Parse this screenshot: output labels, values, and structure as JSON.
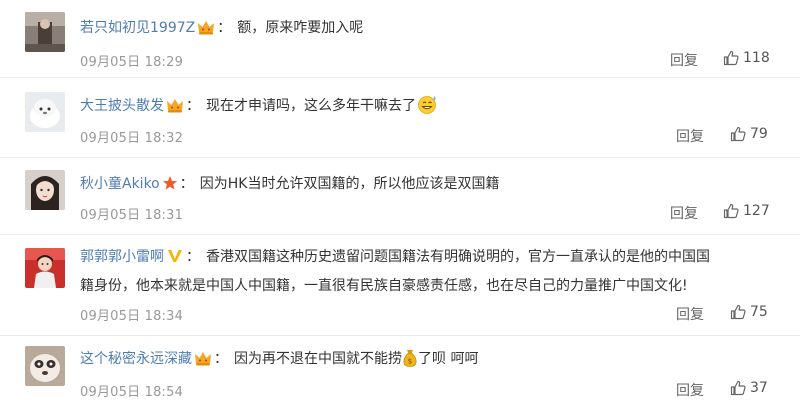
{
  "comments": [
    {
      "username": "若只如初见1997Z",
      "badge": "crown-icon",
      "text": "额，原来咋要加入呢",
      "text_suffix": "",
      "time": "09月05日 18:29",
      "reply_label": "回复",
      "likes": "118"
    },
    {
      "username": "大王披头散发",
      "badge": "crown-icon",
      "text": "现在才申请吗，这么多年干嘛去了",
      "text_suffix": "",
      "emoji": "sweat-grin-emoji",
      "time": "09月05日 18:32",
      "reply_label": "回复",
      "likes": "79"
    },
    {
      "username": "秋小童Akiko",
      "badge": "star-icon",
      "text": "因为HK当时允许双国籍的，所以他应该是双国籍",
      "text_suffix": "",
      "time": "09月05日 18:31",
      "reply_label": "回复",
      "likes": "127"
    },
    {
      "username": "郭郭郭小雷啊",
      "badge": "verified-v-icon",
      "text": "香港双国籍这种历史遗留问题国籍法有明确说明的，官方一直承认的是他的中国国籍身份，他本来就是中国人中国籍，一直很有民族自豪感责任感，也在尽自己的力量推广中国文化!",
      "text_suffix": "",
      "time": "09月05日 18:34",
      "reply_label": "回复",
      "likes": "75"
    },
    {
      "username": "这个秘密永远深藏",
      "badge": "crown-icon",
      "text": "因为再不退在中国就不能捞",
      "text_suffix": "了呗 呵呵",
      "emoji": "money-bag-emoji",
      "time": "09月05日 18:54",
      "reply_label": "回复",
      "likes": "37"
    }
  ],
  "colors": {
    "username": "#4f7db3",
    "text": "#333333",
    "meta": "#999999",
    "crown": "#f5a623",
    "star": "#f05a28"
  }
}
